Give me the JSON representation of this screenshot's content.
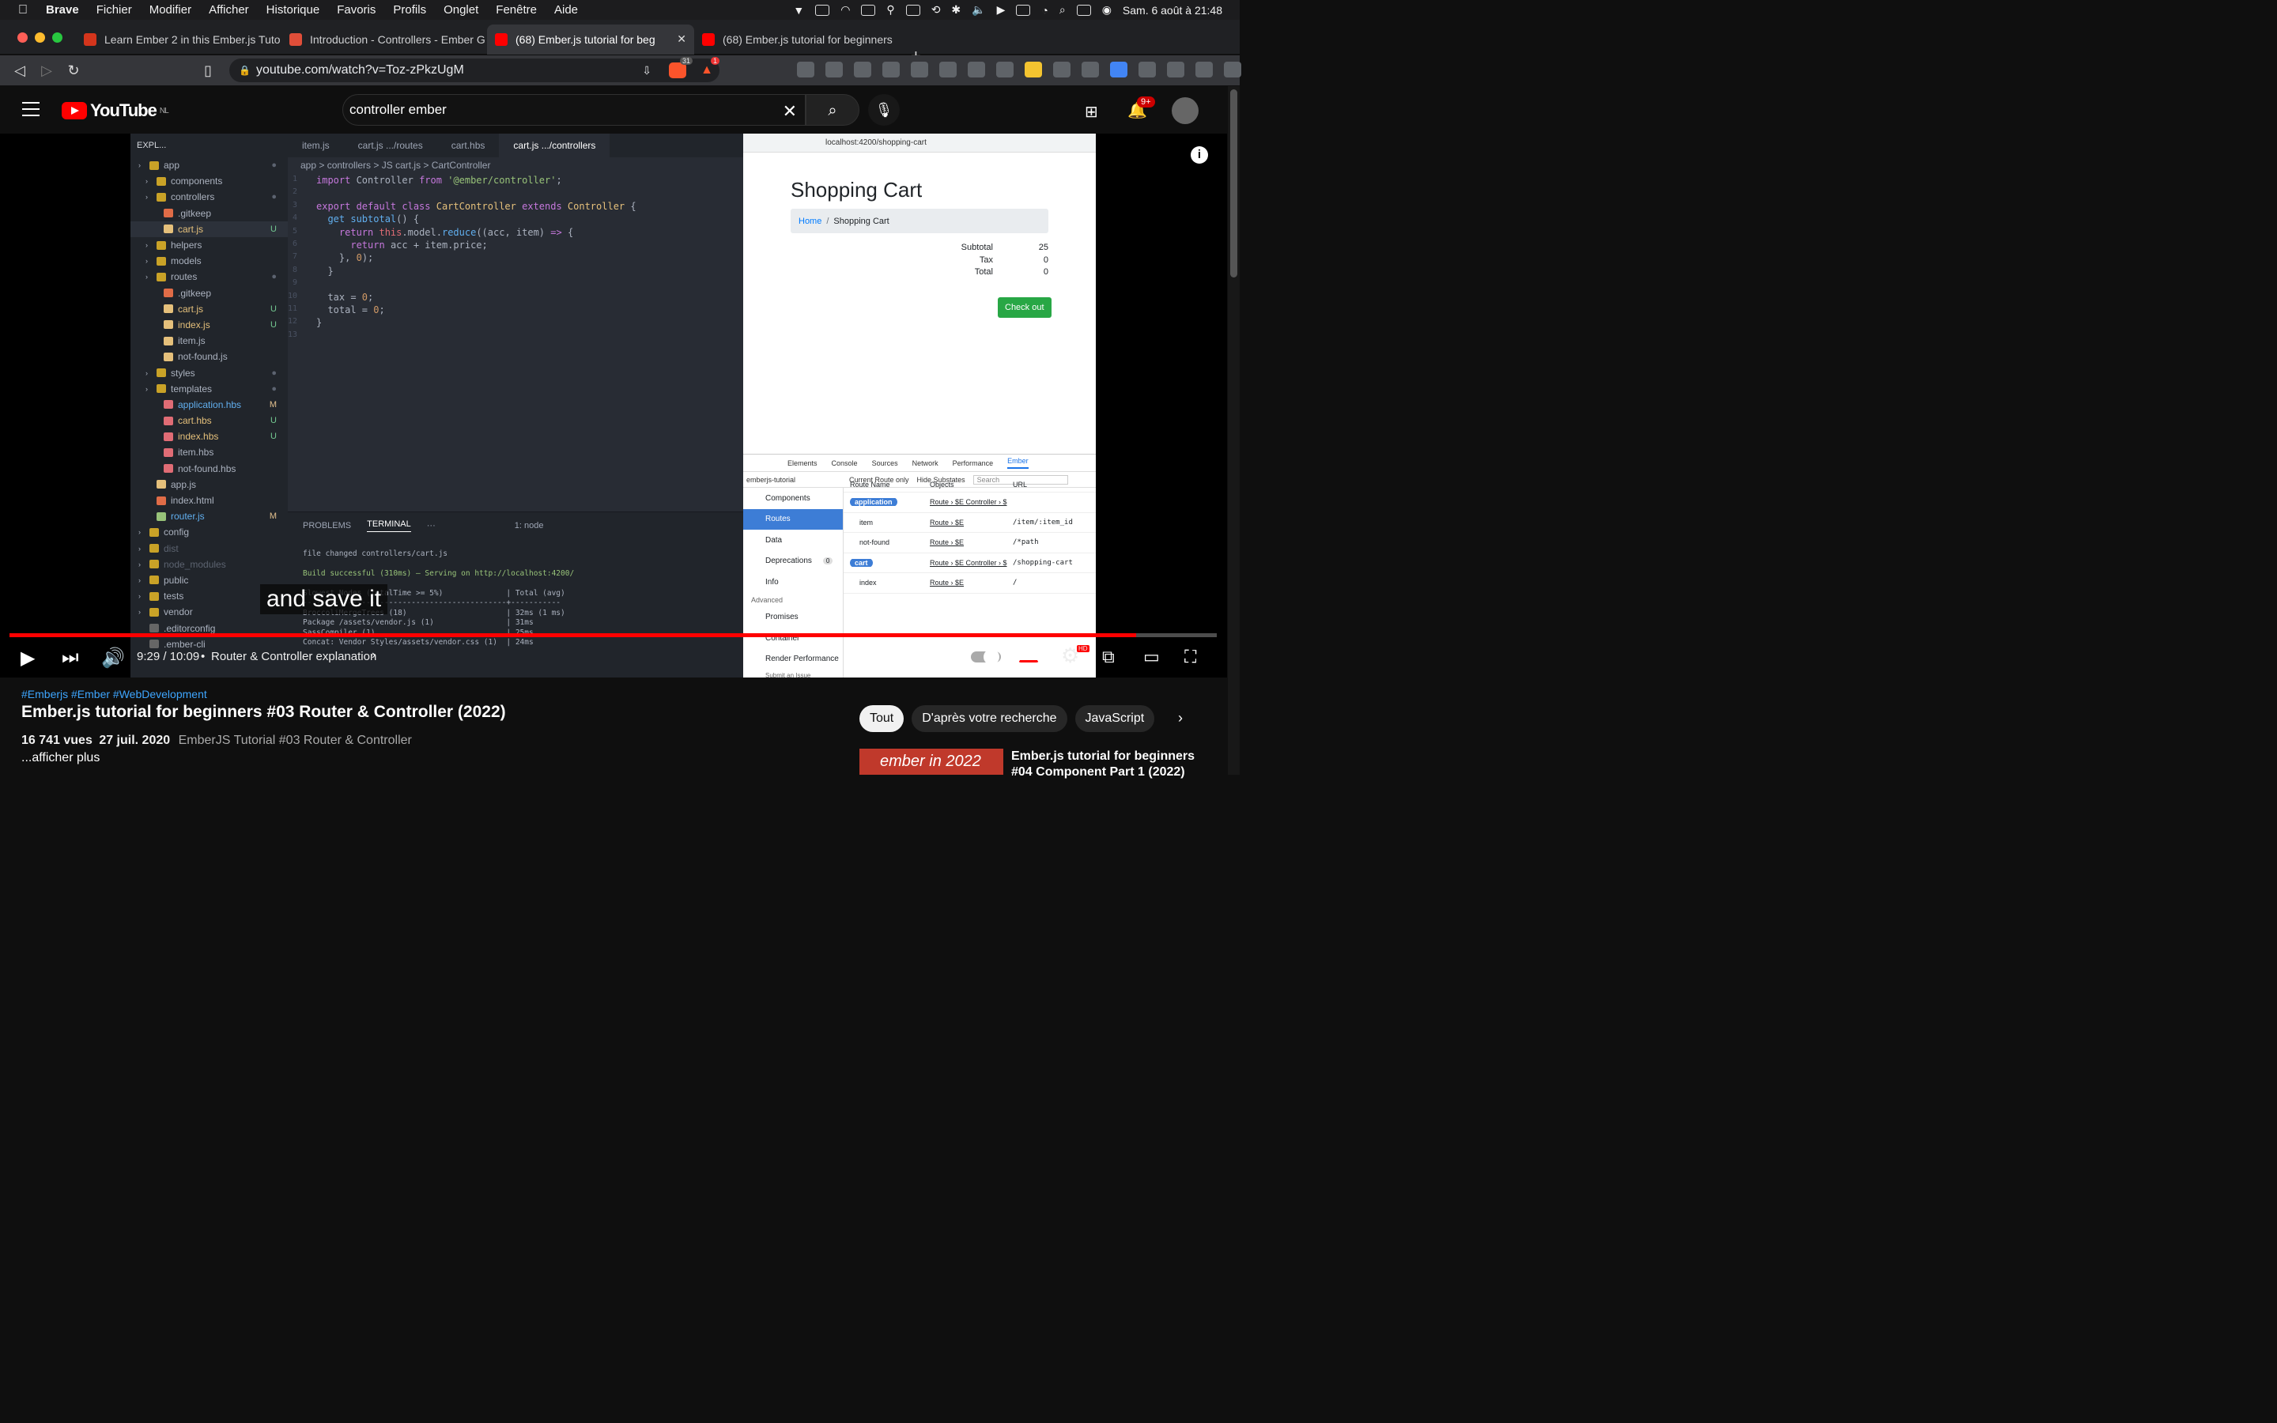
{
  "menubar": {
    "app": "Brave",
    "items": [
      "Fichier",
      "Modifier",
      "Afficher",
      "Historique",
      "Favoris",
      "Profils",
      "Onglet",
      "Fenêtre",
      "Aide"
    ],
    "datetime": "Sam. 6 août à  21:48"
  },
  "tabs": [
    {
      "title": "Learn Ember 2 in this Ember.js Tuto",
      "color": "#d4351c"
    },
    {
      "title": "Introduction - Controllers - Ember G",
      "color": "#e04e39"
    },
    {
      "title": "(68) Ember.js tutorial for beg",
      "color": "#ff0000"
    },
    {
      "title": "(68) Ember.js tutorial for beginners",
      "color": "#ff0000"
    }
  ],
  "url": "youtube.com/watch?v=Toz-zPkzUgM",
  "brave_badges": {
    "shield": "31",
    "rewards": "1"
  },
  "youtube": {
    "logo": "YouTube",
    "region": "NL",
    "search_value": "controller ember",
    "notif_count": "9+"
  },
  "vscode": {
    "explorer_title": "EXPL...",
    "tree": [
      {
        "label": "app",
        "indent": 0,
        "color": "#abb2bf",
        "status": "●",
        "type": "folder"
      },
      {
        "label": "components",
        "indent": 1,
        "color": "#abb2bf",
        "status": "",
        "type": "folder"
      },
      {
        "label": "controllers",
        "indent": 1,
        "color": "#abb2bf",
        "status": "●",
        "type": "folder"
      },
      {
        "label": ".gitkeep",
        "indent": 2,
        "color": "#abb2bf",
        "status": "",
        "type": "git"
      },
      {
        "label": "cart.js",
        "indent": 2,
        "color": "#e5c07b",
        "status": "U",
        "type": "js",
        "sel": true
      },
      {
        "label": "helpers",
        "indent": 1,
        "color": "#abb2bf",
        "status": "",
        "type": "folder"
      },
      {
        "label": "models",
        "indent": 1,
        "color": "#abb2bf",
        "status": "",
        "type": "folder"
      },
      {
        "label": "routes",
        "indent": 1,
        "color": "#abb2bf",
        "status": "●",
        "type": "folder"
      },
      {
        "label": ".gitkeep",
        "indent": 2,
        "color": "#abb2bf",
        "status": "",
        "type": "git"
      },
      {
        "label": "cart.js",
        "indent": 2,
        "color": "#e5c07b",
        "status": "U",
        "type": "js"
      },
      {
        "label": "index.js",
        "indent": 2,
        "color": "#e5c07b",
        "status": "U",
        "type": "js"
      },
      {
        "label": "item.js",
        "indent": 2,
        "color": "#abb2bf",
        "status": "",
        "type": "js"
      },
      {
        "label": "not-found.js",
        "indent": 2,
        "color": "#abb2bf",
        "status": "",
        "type": "js"
      },
      {
        "label": "styles",
        "indent": 1,
        "color": "#abb2bf",
        "status": "●",
        "type": "folder"
      },
      {
        "label": "templates",
        "indent": 1,
        "color": "#abb2bf",
        "status": "●",
        "type": "folder"
      },
      {
        "label": "application.hbs",
        "indent": 2,
        "color": "#61afef",
        "status": "M",
        "type": "hbs"
      },
      {
        "label": "cart.hbs",
        "indent": 2,
        "color": "#e5c07b",
        "status": "U",
        "type": "hbs"
      },
      {
        "label": "index.hbs",
        "indent": 2,
        "color": "#e5c07b",
        "status": "U",
        "type": "hbs"
      },
      {
        "label": "item.hbs",
        "indent": 2,
        "color": "#abb2bf",
        "status": "",
        "type": "hbs"
      },
      {
        "label": "not-found.hbs",
        "indent": 2,
        "color": "#abb2bf",
        "status": "",
        "type": "hbs"
      },
      {
        "label": "app.js",
        "indent": 1,
        "color": "#abb2bf",
        "status": "",
        "type": "js"
      },
      {
        "label": "index.html",
        "indent": 1,
        "color": "#abb2bf",
        "status": "",
        "type": "html"
      },
      {
        "label": "router.js",
        "indent": 1,
        "color": "#61afef",
        "status": "M",
        "type": "router"
      },
      {
        "label": "config",
        "indent": 0,
        "color": "#abb2bf",
        "status": "",
        "type": "folder"
      },
      {
        "label": "dist",
        "indent": 0,
        "color": "#5c6370",
        "status": "",
        "type": "folder"
      },
      {
        "label": "node_modules",
        "indent": 0,
        "color": "#5c6370",
        "status": "",
        "type": "folder"
      },
      {
        "label": "public",
        "indent": 0,
        "color": "#abb2bf",
        "status": "",
        "type": "folder"
      },
      {
        "label": "tests",
        "indent": 0,
        "color": "#abb2bf",
        "status": "",
        "type": "folder"
      },
      {
        "label": "vendor",
        "indent": 0,
        "color": "#abb2bf",
        "status": "",
        "type": "folder"
      },
      {
        "label": ".editorconfig",
        "indent": 0,
        "color": "#abb2bf",
        "status": "",
        "type": "cfg"
      },
      {
        "label": ".ember-cli",
        "indent": 0,
        "color": "#abb2bf",
        "status": "",
        "type": "cfg"
      }
    ],
    "editor_tabs": [
      "item.js",
      "cart.js .../routes",
      "cart.hbs",
      "cart.js .../controllers"
    ],
    "breadcrumb": "app  >  controllers  >  JS cart.js  >  CartController",
    "code": [
      [
        [
          "k",
          "import "
        ],
        [
          "p",
          "Controller "
        ],
        [
          "k",
          "from "
        ],
        [
          "s",
          "'@ember/controller'"
        ],
        [
          "p",
          ";"
        ]
      ],
      [],
      [
        [
          "k",
          "export default class "
        ],
        [
          "t",
          "CartController "
        ],
        [
          "k",
          "extends "
        ],
        [
          "t",
          "Controller "
        ],
        [
          "p",
          "{"
        ]
      ],
      [
        [
          "p",
          "  "
        ],
        [
          "f",
          "get "
        ],
        [
          "f",
          "subtotal"
        ],
        [
          "p",
          "() {"
        ]
      ],
      [
        [
          "p",
          "    "
        ],
        [
          "k",
          "return "
        ],
        [
          "v",
          "this"
        ],
        [
          "p",
          ".model."
        ],
        [
          "f",
          "reduce"
        ],
        [
          "p",
          "((acc, item) "
        ],
        [
          "k",
          "=> "
        ],
        [
          "p",
          "{"
        ]
      ],
      [
        [
          "p",
          "      "
        ],
        [
          "k",
          "return "
        ],
        [
          "p",
          "acc + item.price;"
        ]
      ],
      [
        [
          "p",
          "    }, "
        ],
        [
          "n",
          "0"
        ],
        [
          "p",
          ");"
        ]
      ],
      [
        [
          "p",
          "  }"
        ]
      ],
      [],
      [
        [
          "p",
          "  tax = "
        ],
        [
          "n",
          "0"
        ],
        [
          "p",
          ";"
        ]
      ],
      [
        [
          "p",
          "  total = "
        ],
        [
          "n",
          "0"
        ],
        [
          "p",
          ";"
        ]
      ],
      [
        [
          "p",
          "}"
        ]
      ],
      []
    ],
    "terminal_tabs": [
      "PROBLEMS",
      "TERMINAL",
      "1: node"
    ],
    "terminal_lines": [
      "",
      "file changed controllers/cart.js",
      "",
      "Build successful (310ms) – Serving on http://localhost:4200/",
      "",
      "Slowest Nodes (totalTime >= 5%)              | Total (avg)",
      "---------------------------------------------+-----------",
      "BroccoliMergeTrees (18)                      | 32ms (1 ms)",
      "Package /assets/vendor.js (1)                | 31ms",
      "SassCompiler (1)                             | 25ms",
      "Concat: Vendor Styles/assets/vendor.css (1)  | 24ms"
    ]
  },
  "shop": {
    "url": "localhost:4200/shopping-cart",
    "heading": "Shopping Cart",
    "crumb_home": "Home",
    "crumb_current": "Shopping Cart",
    "totals": [
      {
        "label": "Subtotal",
        "value": "25"
      },
      {
        "label": "Tax",
        "value": "0"
      },
      {
        "label": "Total",
        "value": "0"
      }
    ],
    "checkout": "Check out"
  },
  "devtools": {
    "tabs": [
      "Elements",
      "Console",
      "Sources",
      "Network",
      "Performance",
      "Ember"
    ],
    "app_select": "emberjs-tutorial",
    "current_route_only": "Current Route only",
    "hide_substates": "Hide Substates",
    "search_placeholder": "Search",
    "sidebar": [
      "Components",
      "Routes",
      "Data",
      "Deprecations",
      "Info",
      "Advanced",
      "Promises",
      "Container",
      "Render Performance",
      "Submit an Issue"
    ],
    "deprecations_count": "0",
    "columns": [
      "Route Name",
      "Objects",
      "URL"
    ],
    "rows": [
      {
        "name": "application",
        "pill": true,
        "objects": "Route › $E   Controller › $",
        "url": ""
      },
      {
        "name": "item",
        "pill": false,
        "objects": "Route › $E",
        "url": "/item/:item_id"
      },
      {
        "name": "not-found",
        "pill": false,
        "objects": "Route › $E",
        "url": "/*path"
      },
      {
        "name": "cart",
        "pill": true,
        "objects": "Route › $E   Controller › $",
        "url": "/shopping-cart"
      },
      {
        "name": "index",
        "pill": false,
        "objects": "Route › $E",
        "url": "/"
      }
    ]
  },
  "player": {
    "caption": "and save it",
    "time": "9:29 / 10:09",
    "chapter": "Router & Controller explanation",
    "progress": 0.933
  },
  "video": {
    "tags": "#Emberjs #Ember #WebDevelopment",
    "title": "Ember.js tutorial for beginners #03 Router & Controller (2022)",
    "views": "16 741 vues",
    "date": "27 juil. 2020",
    "desc": "EmberJS Tutorial #03 Router & Controller",
    "more": "...afficher plus"
  },
  "chips": [
    "Tout",
    "D'après votre recherche",
    "JavaScript"
  ],
  "recommendation": {
    "thumb_text": "ember  in 2022",
    "title": "Ember.js tutorial for beginners #04 Component Part 1 (2022)"
  }
}
